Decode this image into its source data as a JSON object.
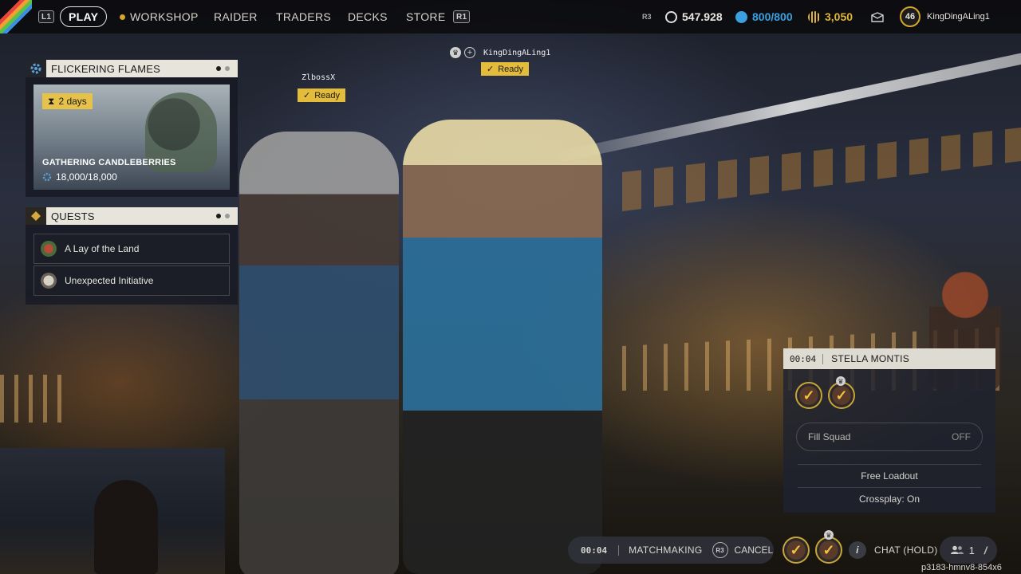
{
  "nav": {
    "l1": "L1",
    "r1": "R1",
    "items": [
      "PLAY",
      "WORKSHOP",
      "RAIDER",
      "TRADERS",
      "DECKS",
      "STORE"
    ]
  },
  "currencies": {
    "r3": "R3",
    "coins": "547.928",
    "storage": "800/800",
    "tokens": "3,050"
  },
  "player": {
    "level": "46",
    "name": "KingDingALing1"
  },
  "event": {
    "header": "FLICKERING FLAMES",
    "days_left": "2 days",
    "title": "GATHERING CANDLEBERRIES",
    "progress": "18,000/18,000"
  },
  "quests": {
    "header": "QUESTS",
    "items": [
      "A Lay of the Land",
      "Unexpected Initiative"
    ]
  },
  "lobby": {
    "member1_name": "ZlbossX",
    "member1_status": "Ready",
    "member2_name": "KingDingALing1",
    "member2_status": "Ready"
  },
  "squad": {
    "timer": "00:04",
    "map": "STELLA MONTIS",
    "fill_label": "Fill Squad",
    "fill_value": "OFF",
    "loadout": "Free Loadout",
    "crossplay": "Crossplay: On"
  },
  "bottom": {
    "timer": "00:04",
    "matchmaking": "MATCHMAKING",
    "r3": "R3",
    "cancel": "CANCEL",
    "chat": "CHAT (HOLD)",
    "party_count": "1",
    "build": "p3183-hmnv8-854x6"
  },
  "colors": {
    "accent_gold": "#e3bc3c",
    "storage_blue": "#3aa0e0",
    "panel_header": "#e7e4dc"
  },
  "icons": {
    "coins": "coin-icon",
    "storage": "storage-icon",
    "tokens": "token-icon",
    "mail": "mail-icon"
  }
}
